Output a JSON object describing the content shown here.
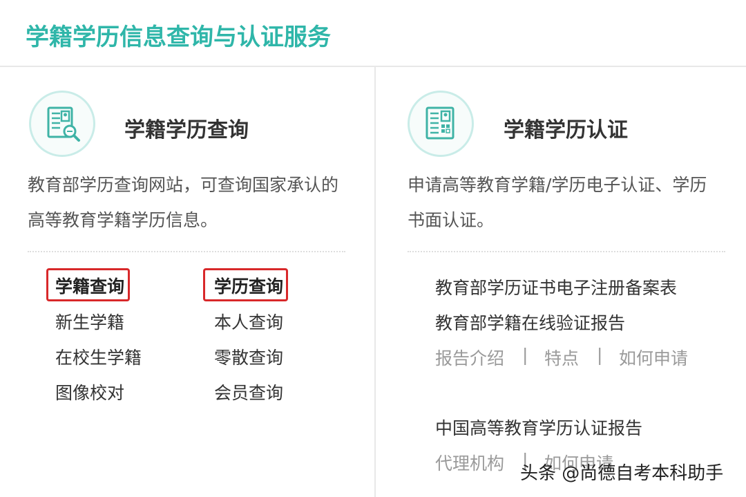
{
  "header": {
    "title": "学籍学历信息查询与认证服务"
  },
  "left": {
    "icon": "document-search-icon",
    "title": "学籍学历查询",
    "desc_line1": "教育部学历查询网站，可查询国家承认的",
    "desc_line2": "高等教育学籍学历信息。",
    "col1": [
      "学籍查询",
      "新生学籍",
      "在校生学籍",
      "图像校对"
    ],
    "col2": [
      "学历查询",
      "本人查询",
      "零散查询",
      "会员查询"
    ]
  },
  "right": {
    "icon": "document-qr-icon",
    "title": "学籍学历认证",
    "desc_line1": "申请高等教育学籍/学历电子认证、学历",
    "desc_line2": "书面认证。",
    "item1": "教育部学历证书电子注册备案表",
    "item2": "教育部学籍在线验证报告",
    "sub_links": [
      "报告介绍",
      "特点",
      "如何申请"
    ],
    "item3": "中国高等教育学历认证报告",
    "sub_links2": [
      "代理机构",
      "如何申请"
    ],
    "separator": "|"
  },
  "watermark": "头条 @尚德自考本科助手",
  "colors": {
    "accent": "#2fb6a9",
    "highlight": "#d8282a",
    "muted": "#9a9a9a"
  }
}
